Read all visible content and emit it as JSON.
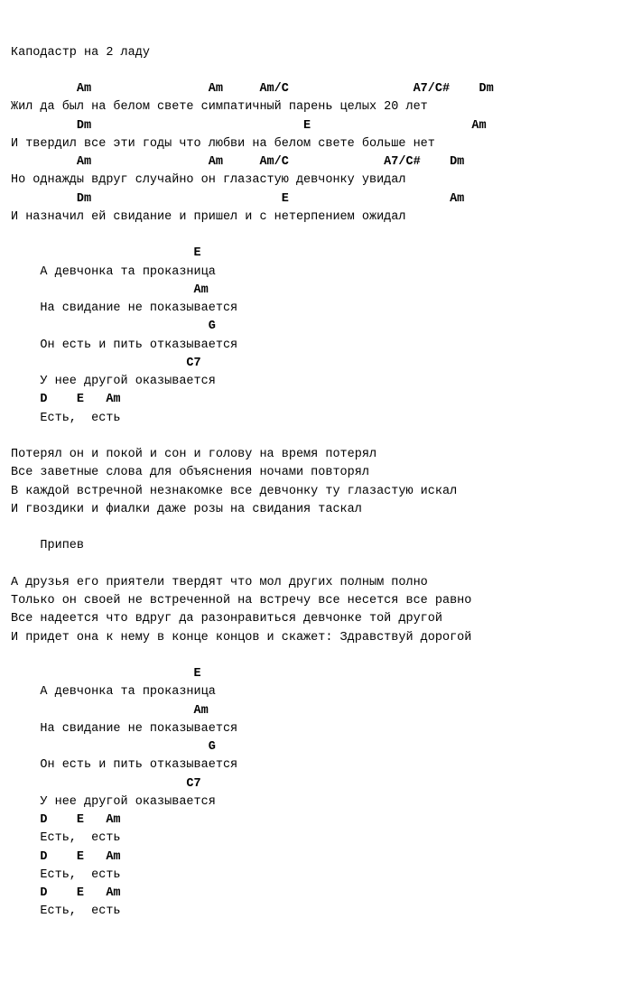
{
  "lines": [
    {
      "text": "Каподастр на 2 ладу",
      "chord": false
    },
    {
      "text": "",
      "chord": false
    },
    {
      "text": "         Am                Am     Am/C                 A7/C#    Dm",
      "chord": true
    },
    {
      "text": "Жил да был на белом свете симпатичный парень целых 20 лет",
      "chord": false
    },
    {
      "text": "         Dm                             E                      Am",
      "chord": true
    },
    {
      "text": "И твердил все эти годы что любви на белом свете больше нет",
      "chord": false
    },
    {
      "text": "         Am                Am     Am/C             A7/C#    Dm",
      "chord": true
    },
    {
      "text": "Но однажды вдруг случайно он глазастую девчонку увидал",
      "chord": false
    },
    {
      "text": "         Dm                          E                      Am",
      "chord": true
    },
    {
      "text": "И назначил ей свидание и пришел и с нетерпением ожидал",
      "chord": false
    },
    {
      "text": "",
      "chord": false
    },
    {
      "text": "                         E",
      "chord": true
    },
    {
      "text": "    А девчонка та проказница",
      "chord": false
    },
    {
      "text": "                         Am",
      "chord": true
    },
    {
      "text": "    На свидание не показывается",
      "chord": false
    },
    {
      "text": "                           G",
      "chord": true
    },
    {
      "text": "    Он есть и пить отказывается",
      "chord": false
    },
    {
      "text": "                        C7",
      "chord": true
    },
    {
      "text": "    У нее другой оказывается",
      "chord": false
    },
    {
      "text": "    D    E   Am",
      "chord": true
    },
    {
      "text": "    Есть,  есть",
      "chord": false
    },
    {
      "text": "",
      "chord": false
    },
    {
      "text": "Потерял он и покой и сон и голову на время потерял",
      "chord": false
    },
    {
      "text": "Все заветные слова для объяснения ночами повторял",
      "chord": false
    },
    {
      "text": "В каждой встречной незнакомке все девчонку ту глазастую искал",
      "chord": false
    },
    {
      "text": "И гвоздики и фиалки даже розы на свидания таскал",
      "chord": false
    },
    {
      "text": "",
      "chord": false
    },
    {
      "text": "    Припев",
      "chord": false
    },
    {
      "text": "",
      "chord": false
    },
    {
      "text": "А друзья его приятели твердят что мол других полным полно",
      "chord": false
    },
    {
      "text": "Только он своей не встреченной на встречу все несется все равно",
      "chord": false
    },
    {
      "text": "Все надеется что вдруг да разонравиться девчонке той другой",
      "chord": false
    },
    {
      "text": "И придет она к нему в конце концов и скажет: Здравствуй дорогой",
      "chord": false
    },
    {
      "text": "",
      "chord": false
    },
    {
      "text": "                         E",
      "chord": true
    },
    {
      "text": "    А девчонка та проказница",
      "chord": false
    },
    {
      "text": "                         Am",
      "chord": true
    },
    {
      "text": "    На свидание не показывается",
      "chord": false
    },
    {
      "text": "                           G",
      "chord": true
    },
    {
      "text": "    Он есть и пить отказывается",
      "chord": false
    },
    {
      "text": "                        C7",
      "chord": true
    },
    {
      "text": "    У нее другой оказывается",
      "chord": false
    },
    {
      "text": "    D    E   Am",
      "chord": true
    },
    {
      "text": "    Есть,  есть",
      "chord": false
    },
    {
      "text": "    D    E   Am",
      "chord": true
    },
    {
      "text": "    Есть,  есть",
      "chord": false
    },
    {
      "text": "    D    E   Am",
      "chord": true
    },
    {
      "text": "    Есть,  есть",
      "chord": false
    }
  ]
}
